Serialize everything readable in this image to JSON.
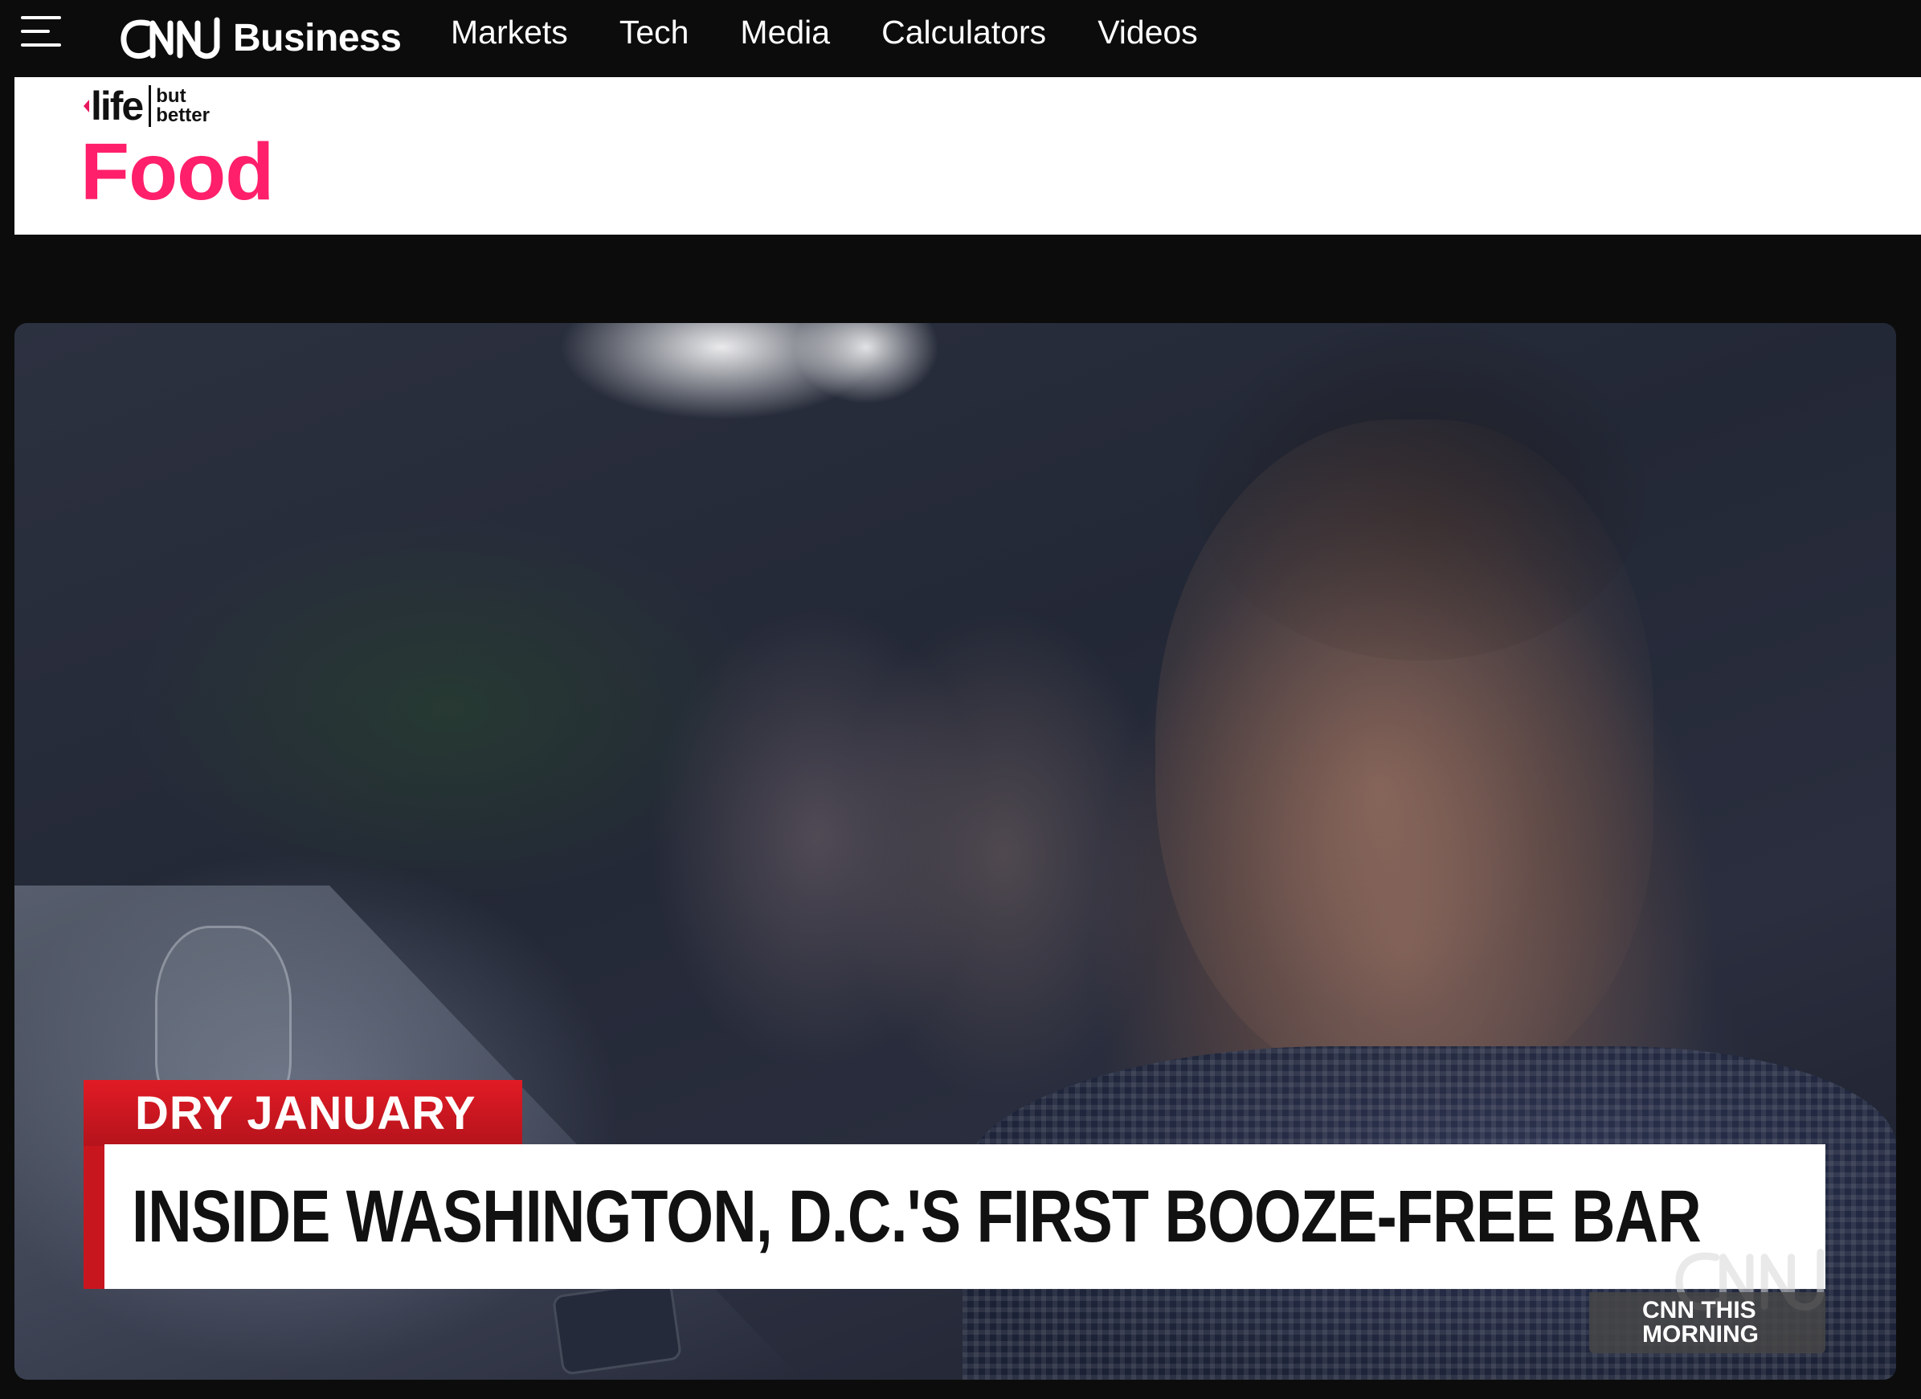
{
  "topnav": {
    "brand_logo": "CNN",
    "brand_section": "Business",
    "links": [
      "Markets",
      "Tech",
      "Media",
      "Calculators",
      "Videos"
    ]
  },
  "section": {
    "logo_life": "life",
    "logo_tag_line1": "but",
    "logo_tag_line2": "better",
    "title": "Food"
  },
  "video": {
    "kicker": "DRY JANUARY",
    "headline": "INSIDE WASHINGTON, D.C.'S FIRST BOOZE-FREE BAR",
    "show_line1": "CNN THIS",
    "show_line2": "MORNING",
    "bug_logo": "CNN"
  },
  "colors": {
    "nav_bg": "#0c0c0c",
    "section_accent": "#ff1f6a",
    "lower_third_red": "#e11b25"
  },
  "icons": [
    "hamburger-menu-icon",
    "cnn-logo-icon",
    "life-but-better-logo"
  ]
}
